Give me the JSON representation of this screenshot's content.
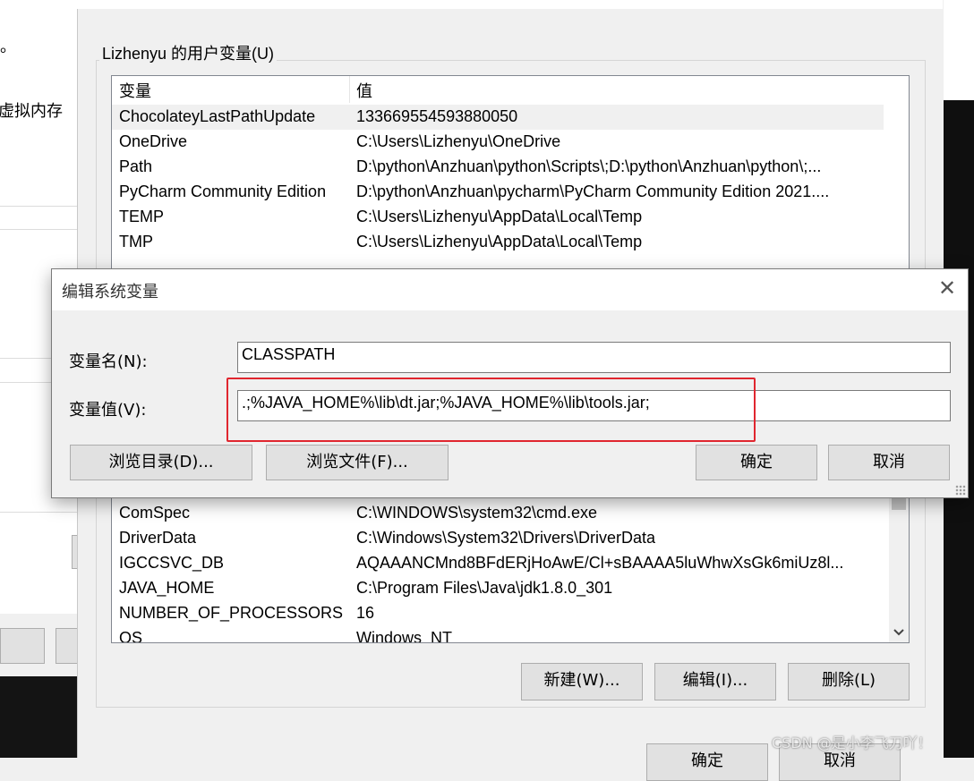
{
  "background_window": {
    "text_top": "。",
    "text_virtual_memory": "虚拟内存"
  },
  "env_dialog": {
    "user_group_label": "Lizhenyu 的用户变量(U)",
    "user_vars_headers": [
      "变量",
      "值"
    ],
    "user_vars": [
      {
        "name": "ChocolateyLastPathUpdate",
        "value": "133669554593880050"
      },
      {
        "name": "OneDrive",
        "value": "C:\\Users\\Lizhenyu\\OneDrive"
      },
      {
        "name": "Path",
        "value": "D:\\python\\Anzhuan\\python\\Scripts\\;D:\\python\\Anzhuan\\python\\;..."
      },
      {
        "name": "PyCharm Community Edition",
        "value": "D:\\python\\Anzhuan\\pycharm\\PyCharm Community Edition 2021...."
      },
      {
        "name": "TEMP",
        "value": "C:\\Users\\Lizhenyu\\AppData\\Local\\Temp"
      },
      {
        "name": "TMP",
        "value": "C:\\Users\\Lizhenyu\\AppData\\Local\\Temp"
      }
    ],
    "system_vars": [
      {
        "name": "ComSpec",
        "value": "C:\\WINDOWS\\system32\\cmd.exe"
      },
      {
        "name": "DriverData",
        "value": "C:\\Windows\\System32\\Drivers\\DriverData"
      },
      {
        "name": "IGCCSVC_DB",
        "value": "AQAAANCMnd8BFdERjHoAwE/Cl+sBAAAA5luWhwXsGk6miUz8l..."
      },
      {
        "name": "JAVA_HOME",
        "value": "C:\\Program Files\\Java\\jdk1.8.0_301"
      },
      {
        "name": "NUMBER_OF_PROCESSORS",
        "value": "16"
      },
      {
        "name": "OS",
        "value": "Windows_NT"
      }
    ],
    "buttons": {
      "new": "新建(W)...",
      "edit": "编辑(I)...",
      "delete": "删除(L)",
      "ok": "确定",
      "cancel": "取消"
    }
  },
  "edit_dialog": {
    "title": "编辑系统变量",
    "name_label": "变量名(N):",
    "name_value": "CLASSPATH",
    "value_label": "变量值(V):",
    "value_value": ".;%JAVA_HOME%\\lib\\dt.jar;%JAVA_HOME%\\lib\\tools.jar;",
    "buttons": {
      "browse_dir": "浏览目录(D)...",
      "browse_file": "浏览文件(F)...",
      "ok": "确定",
      "cancel": "取消"
    },
    "highlight_color": "#e0262f"
  },
  "watermark": "CSDN @是小李飞刀吖！"
}
